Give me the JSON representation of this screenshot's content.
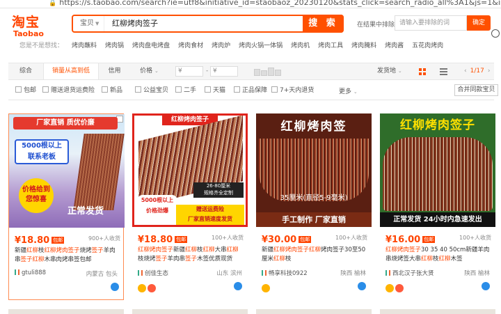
{
  "browser": {
    "url": "https://s.taobao.com/search?ie=utf8&initiative_id=staobaoz_20230120&stats_click=search_radio_all%3A1&js=1&imgfile=&"
  },
  "header": {
    "logo_cn": "淘宝",
    "logo_en": "Taobao",
    "search_scope": "宝贝",
    "search_query": "红柳烤肉签子",
    "search_button": "搜 索",
    "exclude_label": "在结果中排除",
    "exclude_placeholder": "请输入要排除的词",
    "confirm_button": "确定"
  },
  "suggestions": {
    "lead": "您是不是想找：",
    "items": [
      "烤肉蘸料",
      "烤肉锅",
      "烤肉盘电烤盘",
      "烤肉食材",
      "烤肉炉",
      "烤肉火锅一体锅",
      "烤肉机",
      "烤肉工具",
      "烤肉腌料",
      "烤肉酱",
      "五花肉烤肉"
    ]
  },
  "sortbar": {
    "items": [
      "综合",
      "销量从高到低",
      "信用",
      "价格"
    ],
    "price_min_prefix": "¥",
    "price_max_prefix": "¥",
    "dash": "-",
    "ship_from": "发货地",
    "page": "1/17"
  },
  "filters": {
    "checkboxes": [
      "包邮",
      "赠送退货运费险",
      "新品",
      "公益宝贝",
      "二手",
      "天猫",
      "正品保障",
      "7+天内退货"
    ],
    "more": "更多",
    "merge_button": "合并同款宝贝"
  },
  "products": [
    {
      "img_banner": "厂家直销  质优价廉",
      "img_box": "5000根以上\n联系老板",
      "img_burst": "价格给到\n您惊喜",
      "img_footer": "正常发货",
      "price": "¥18.80",
      "badge": "包邮",
      "sold": "900+人收货",
      "title_parts": [
        {
          "t": "新疆",
          "hl": false
        },
        {
          "t": "红柳",
          "hl": true
        },
        {
          "t": "枝",
          "hl": false
        },
        {
          "t": "红柳烤肉签子",
          "hl": true
        },
        {
          "t": "烧烤",
          "hl": false
        },
        {
          "t": "签子",
          "hl": true
        },
        {
          "t": "羊肉串",
          "hl": false
        },
        {
          "t": "签子红柳",
          "hl": true
        },
        {
          "t": "木串肉烤串签包邮",
          "hl": false
        }
      ],
      "shop": "gtuli888",
      "location": "内蒙古 包头"
    },
    {
      "img_banner": "红柳烤肉签子",
      "img_box": "5000根以上\n价格劲爆",
      "img_burst": "26-80厘米\n规格齐全定制",
      "img_footer": "赠送运费险\n厂家直销速度发货",
      "price": "¥18.80",
      "badge": "包邮",
      "sold": "100+人收货",
      "title_parts": [
        {
          "t": "红柳烤肉签子",
          "hl": true
        },
        {
          "t": "新疆",
          "hl": false
        },
        {
          "t": "红柳",
          "hl": true
        },
        {
          "t": "枝",
          "hl": false
        },
        {
          "t": "红柳",
          "hl": true
        },
        {
          "t": "大串",
          "hl": false
        },
        {
          "t": "红柳",
          "hl": true
        },
        {
          "t": "枝烧烤",
          "hl": false
        },
        {
          "t": "签子",
          "hl": true
        },
        {
          "t": "羊肉串",
          "hl": false
        },
        {
          "t": "签子",
          "hl": true
        },
        {
          "t": "木签优质现货",
          "hl": false
        }
      ],
      "shop": "创佳生态",
      "location": "山东 滨州"
    },
    {
      "img_banner": "红柳烤肉签",
      "img_box": "35厘米(直径5-9毫米)",
      "img_burst": "",
      "img_footer": "手工制作    厂家直销",
      "price": "¥30.00",
      "badge": "包邮",
      "sold": "100+人收货",
      "title_parts": [
        {
          "t": "新疆",
          "hl": false
        },
        {
          "t": "红柳烤肉签子红柳",
          "hl": true
        },
        {
          "t": "烤肉签子30至50厘米",
          "hl": false
        },
        {
          "t": "红柳",
          "hl": true
        },
        {
          "t": "枝",
          "hl": false
        }
      ],
      "shop": "畅享科技0922",
      "location": "陕西 榆林"
    },
    {
      "img_banner": "红柳烤肉签子",
      "img_box": "",
      "img_burst": "",
      "img_footer": "正常发货  24小时内急速发出",
      "price": "¥16.00",
      "badge": "包邮",
      "sold": "100+人收货",
      "title_parts": [
        {
          "t": "红柳烤肉签子",
          "hl": true
        },
        {
          "t": "30 35 40 50cm新疆羊肉串烧烤签大串",
          "hl": false
        },
        {
          "t": "红柳",
          "hl": true
        },
        {
          "t": "枝",
          "hl": false
        },
        {
          "t": "红柳",
          "hl": true
        },
        {
          "t": "木签",
          "hl": false
        }
      ],
      "shop": "西北汉子张大贤",
      "location": "陕西 榆林"
    }
  ],
  "colors": {
    "brand": "#ff5000",
    "price": "#ff4400"
  }
}
